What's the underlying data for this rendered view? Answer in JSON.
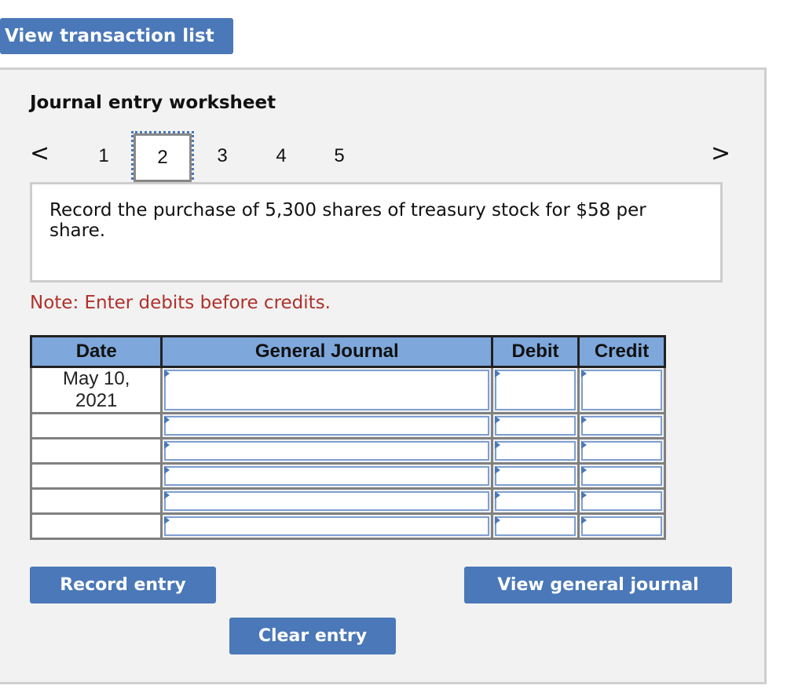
{
  "top_button": "View transaction list",
  "worksheet": {
    "title": "Journal entry worksheet",
    "prev": "<",
    "next": ">",
    "steps": [
      "1",
      "2",
      "3",
      "4",
      "5"
    ],
    "active_step": "2",
    "description": "Record the purchase of 5,300 shares of treasury stock for $58 per share.",
    "note": "Note: Enter debits before credits."
  },
  "table": {
    "headers": [
      "Date",
      "General Journal",
      "Debit",
      "Credit"
    ],
    "rows": [
      {
        "date": "May 10, 2021",
        "account": "",
        "debit": "",
        "credit": ""
      },
      {
        "date": "",
        "account": "",
        "debit": "",
        "credit": ""
      },
      {
        "date": "",
        "account": "",
        "debit": "",
        "credit": ""
      },
      {
        "date": "",
        "account": "",
        "debit": "",
        "credit": ""
      },
      {
        "date": "",
        "account": "",
        "debit": "",
        "credit": ""
      },
      {
        "date": "",
        "account": "",
        "debit": "",
        "credit": ""
      }
    ]
  },
  "buttons": {
    "record": "Record entry",
    "view_gj": "View general journal",
    "clear": "Clear entry"
  }
}
